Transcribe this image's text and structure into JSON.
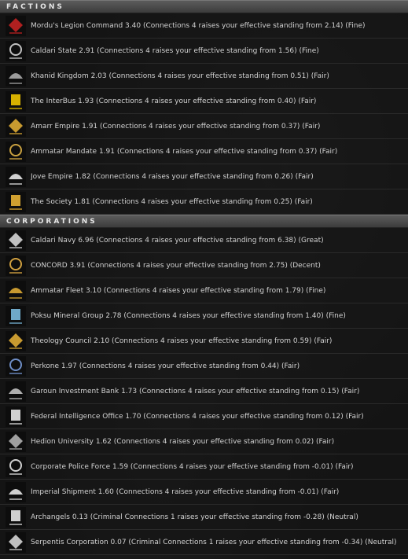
{
  "factions": {
    "header": "FACTIONS",
    "items": [
      {
        "text": "Mordu's Legion Command 3.40  (Connections 4 raises your effective standing from 2.14)  (Fine)",
        "icon": "mordus-legion-logo-icon",
        "color": "#b02020"
      },
      {
        "text": "Caldari State 2.91  (Connections 4 raises your effective standing from 1.56)  (Fine)",
        "icon": "caldari-state-logo-icon",
        "color": "#c0c0c0"
      },
      {
        "text": "Khanid Kingdom 2.03  (Connections 4 raises your effective standing from 0.51)  (Fair)",
        "icon": "khanid-kingdom-logo-icon",
        "color": "#9a9a9a"
      },
      {
        "text": "The InterBus 1.93  (Connections 4 raises your effective standing from 0.40)  (Fair)",
        "icon": "interbus-logo-icon",
        "color": "#d6b000"
      },
      {
        "text": "Amarr Empire 1.91  (Connections 4 raises your effective standing from 0.37)  (Fair)",
        "icon": "amarr-empire-logo-icon",
        "color": "#c89a30"
      },
      {
        "text": "Ammatar Mandate 1.91  (Connections 4 raises your effective standing from 0.37)  (Fair)",
        "icon": "ammatar-mandate-logo-icon",
        "color": "#c8a040"
      },
      {
        "text": "Jove Empire 1.82  (Connections 4 raises your effective standing from 0.26)  (Fair)",
        "icon": "jove-empire-logo-icon",
        "color": "#d0d0d0"
      },
      {
        "text": "The Society 1.81  (Connections 4 raises your effective standing from 0.25)  (Fair)",
        "icon": "the-society-logo-icon",
        "color": "#d0a030"
      }
    ]
  },
  "corporations": {
    "header": "CORPORATIONS",
    "items": [
      {
        "text": "Caldari Navy 6.96  (Connections 4 raises your effective standing from 6.38)  (Great)",
        "icon": "caldari-navy-logo-icon",
        "color": "#c0c0c0"
      },
      {
        "text": "CONCORD 3.91  (Connections 4 raises your effective standing from 2.75)  (Decent)",
        "icon": "concord-logo-icon",
        "color": "#d0a040"
      },
      {
        "text": "Ammatar Fleet 3.10  (Connections 4 raises your effective standing from 1.79)  (Fine)",
        "icon": "ammatar-fleet-logo-icon",
        "color": "#c89a30"
      },
      {
        "text": "Poksu Mineral Group 2.78  (Connections 4 raises your effective standing from 1.40)  (Fine)",
        "icon": "poksu-mineral-group-logo-icon",
        "color": "#6fa8c8"
      },
      {
        "text": "Theology Council 2.10  (Connections 4 raises your effective standing from 0.59)  (Fair)",
        "icon": "theology-council-logo-icon",
        "color": "#c89a30"
      },
      {
        "text": "Perkone 1.97  (Connections 4 raises your effective standing from 0.44)  (Fair)",
        "icon": "perkone-logo-icon",
        "color": "#6f8fc8"
      },
      {
        "text": "Garoun Investment Bank 1.73  (Connections 4 raises your effective standing from 0.15)  (Fair)",
        "icon": "garoun-investment-bank-logo-icon",
        "color": "#b0b0b0"
      },
      {
        "text": "Federal Intelligence Office 1.70  (Connections 4 raises your effective standing from 0.12)  (Fair)",
        "icon": "federal-intelligence-office-logo-icon",
        "color": "#d0d0d0"
      },
      {
        "text": "Hedion University 1.62  (Connections 4 raises your effective standing from 0.02)  (Fair)",
        "icon": "hedion-university-logo-icon",
        "color": "#a0a0a0"
      },
      {
        "text": "Corporate Police Force 1.59  (Connections 4 raises your effective standing from -0.01)  (Fair)",
        "icon": "corporate-police-force-logo-icon",
        "color": "#d0d0d0"
      },
      {
        "text": "Imperial Shipment 1.60  (Connections 4 raises your effective standing from -0.01)  (Fair)",
        "icon": "imperial-shipment-logo-icon",
        "color": "#d0d0d0"
      },
      {
        "text": "Archangels 0.13  (Criminal Connections 1  raises your effective standing from -0.28)  (Neutral)",
        "icon": "archangels-logo-icon",
        "color": "#d0d0d0"
      },
      {
        "text": "Serpentis Corporation 0.07  (Criminal Connections 1  raises your effective standing from -0.34)  (Neutral)",
        "icon": "serpentis-corporation-logo-icon",
        "color": "#c0c0c0"
      }
    ]
  }
}
